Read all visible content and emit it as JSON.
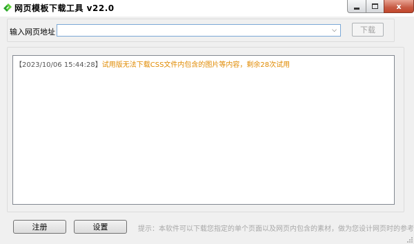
{
  "window": {
    "title": "网页模板下载工具  v22.0",
    "controls": {
      "minimize_icon": "minimize-icon",
      "maximize_icon": "maximize-icon",
      "close_label": "x"
    }
  },
  "url_bar": {
    "label": "输入网页地址",
    "value": "",
    "placeholder": "",
    "download_label": "下载"
  },
  "log": {
    "entries": [
      {
        "timestamp": "【2023/10/06 15:44:28】",
        "message": "试用版无法下载CSS文件内包含的图片等内容，剩余28次试用"
      }
    ]
  },
  "footer": {
    "register_label": "注册",
    "settings_label": "设置",
    "hint": "提示：本软件可以下载您指定的单个页面以及网页内包含的素材，做为您设计网页时的参考"
  },
  "colors": {
    "log_message": "#e08a00",
    "accent_green": "#2aa52a"
  }
}
